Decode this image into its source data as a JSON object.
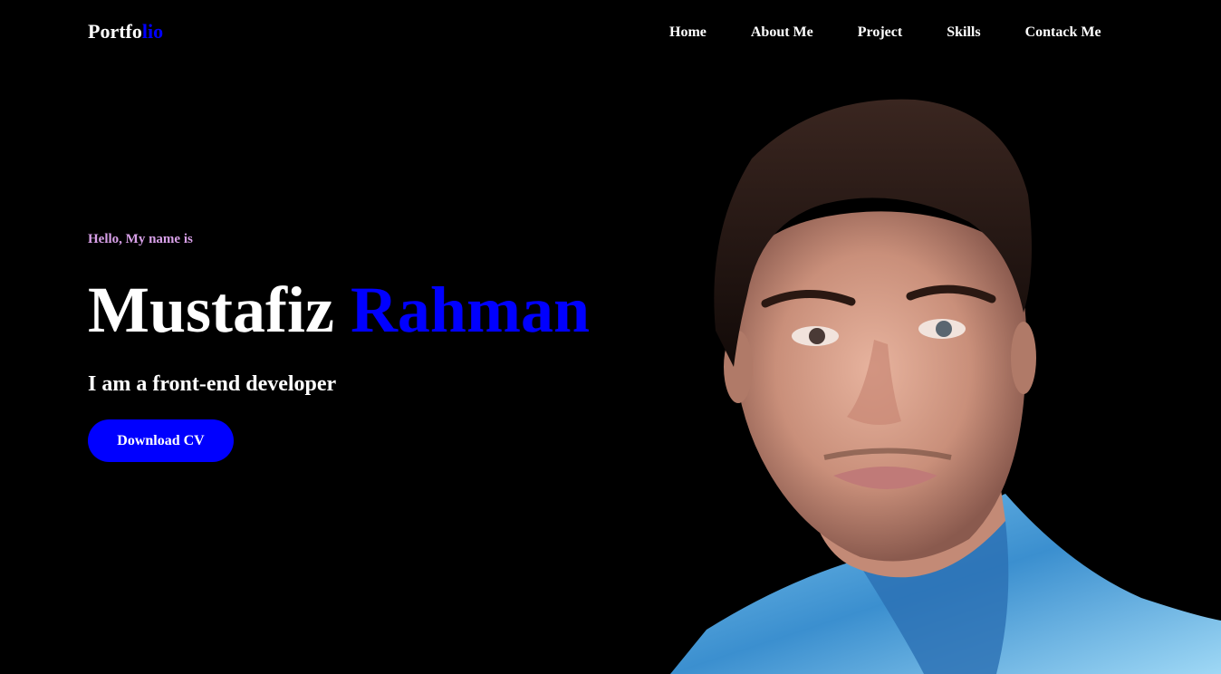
{
  "logo": {
    "main": "Portfo",
    "accent": "lio"
  },
  "nav": {
    "items": [
      "Home",
      "About Me",
      "Project",
      "Skills",
      "Contack Me"
    ]
  },
  "hero": {
    "greeting": "Hello, My name is",
    "first_name": "Mustafiz",
    "last_name": "Rahman",
    "role": "I am a front-end developer",
    "cta_label": "Download CV"
  },
  "colors": {
    "background": "#000000",
    "accent": "#0000ff",
    "greeting": "#d8a0e8",
    "text": "#ffffff"
  }
}
